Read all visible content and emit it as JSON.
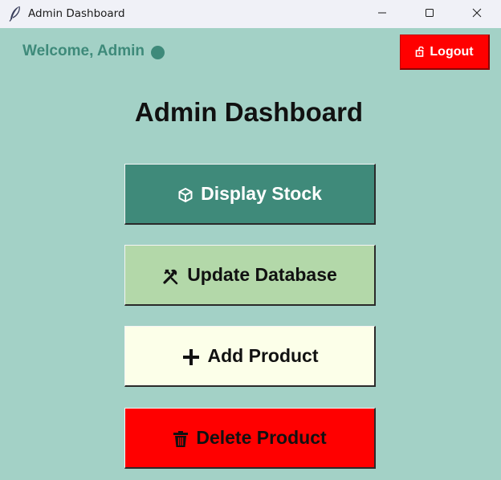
{
  "window": {
    "title": "Admin Dashboard",
    "app_icon": "feather-icon"
  },
  "header": {
    "welcome": "Welcome, Admin",
    "logout_label": "Logout"
  },
  "main": {
    "title": "Admin Dashboard",
    "buttons": {
      "display_stock": {
        "label": "Display Stock",
        "icon": "package-icon"
      },
      "update_database": {
        "label": "Update Database",
        "icon": "tools-icon"
      },
      "add_product": {
        "label": "Add Product",
        "icon": "plus-icon"
      },
      "delete_product": {
        "label": "Delete Product",
        "icon": "trash-icon"
      }
    }
  },
  "colors": {
    "background": "#a3d1c6",
    "teal": "#3f8a7a",
    "light_green": "#b3d8a9",
    "cream": "#fcffe9",
    "red": "#ff0000"
  }
}
